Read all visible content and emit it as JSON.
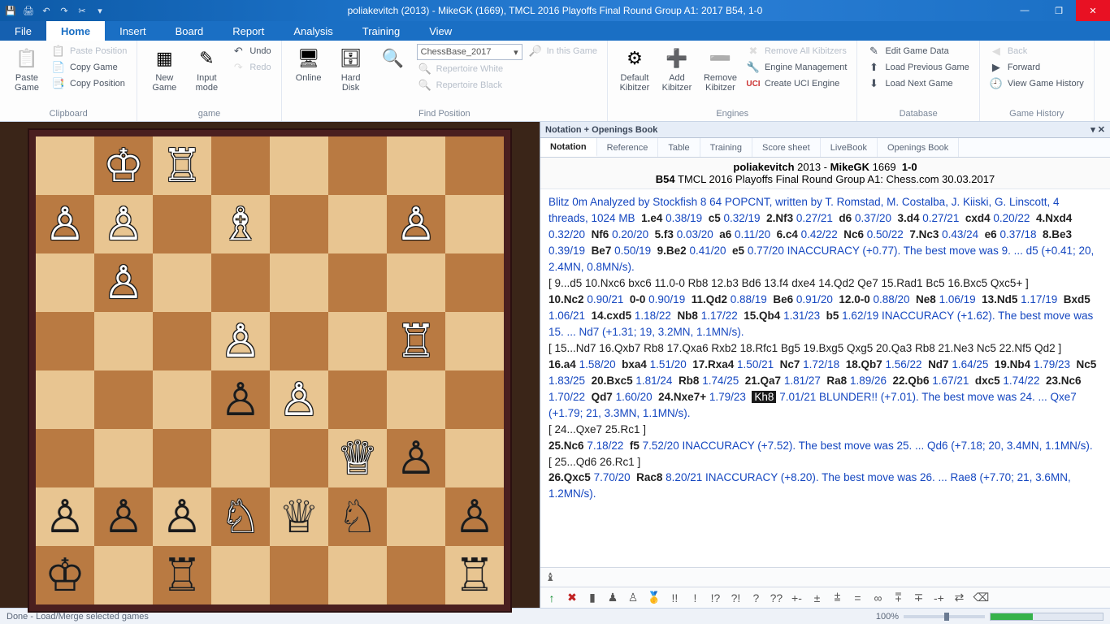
{
  "title": "poliakevitch (2013) - MikeGK (1669), TMCL 2016 Playoffs Final Round Group A1: 2017  B54, 1-0",
  "menus": {
    "file": "File",
    "home": "Home",
    "insert": "Insert",
    "board": "Board",
    "report": "Report",
    "analysis": "Analysis",
    "training": "Training",
    "view": "View"
  },
  "ribbon": {
    "clipboard": {
      "label": "Clipboard",
      "paste_game": "Paste\nGame",
      "paste_position": "Paste Position",
      "copy_game": "Copy Game",
      "copy_position": "Copy Position"
    },
    "game": {
      "label": "game",
      "new_game": "New\nGame",
      "input_mode": "Input\nmode",
      "undo": "Undo",
      "redo": "Redo"
    },
    "find": {
      "label": "Find Position",
      "online": "Online",
      "hard_disk": "Hard\nDisk",
      "combo": "ChessBase_2017",
      "in_this_game": "In this Game",
      "rep_white": "Repertoire White",
      "rep_black": "Repertoire Black"
    },
    "engines": {
      "label": "Engines",
      "default_kibitzer": "Default\nKibitzer",
      "add_kibitzer": "Add\nKibitzer",
      "remove_kibitzer": "Remove\nKibitzer",
      "remove_all": "Remove All Kibitzers",
      "engine_mgmt": "Engine Management",
      "create_uci": "Create UCI Engine"
    },
    "database": {
      "label": "Database",
      "edit_game": "Edit Game Data",
      "load_prev": "Load Previous Game",
      "load_next": "Load Next Game"
    },
    "history": {
      "label": "Game History",
      "back": "Back",
      "forward": "Forward",
      "view_history": "View Game History"
    }
  },
  "pane_title": "Notation + Openings Book",
  "subtabs": [
    "Notation",
    "Reference",
    "Table",
    "Training",
    "Score sheet",
    "LiveBook",
    "Openings Book"
  ],
  "game_header": {
    "white": "poliakevitch",
    "white_elo": "2013",
    "black": "MikeGK",
    "black_elo": "1669",
    "result": "1-0",
    "eco": "B54",
    "event": "TMCL 2016 Playoffs Final Round Group A1: Chess.com 30.03.2017"
  },
  "notation": {
    "intro": "Blitz 0m Analyzed by Stockfish 8 64 POPCNT, written by T. Romstad, M. Costalba, J. Kiiski, G. Linscott, 4 threads, 1024 MB",
    "line1_moves": [
      {
        "n": "1.e4",
        "s": "0.38/19"
      },
      {
        "m": "c5",
        "s": "0.32/19"
      },
      {
        "n": "2.Nf3",
        "s": "0.27/21"
      },
      {
        "m": "d6",
        "s": "0.37/20"
      },
      {
        "n": "3.d4",
        "s": "0.27/21"
      },
      {
        "m": "cxd4",
        "s": "0.20/22"
      },
      {
        "n": "4.Nxd4",
        "s": "0.32/20"
      },
      {
        "m": "Nf6",
        "s": "0.20/20"
      },
      {
        "n": "5.f3",
        "s": "0.03/20"
      },
      {
        "m": "a6",
        "s": "0.11/20"
      },
      {
        "n": "6.c4",
        "s": "0.42/22"
      },
      {
        "m": "Nc6",
        "s": "0.50/22"
      },
      {
        "n": "7.Nc3",
        "s": "0.43/24"
      },
      {
        "m": "e6",
        "s": "0.37/18"
      },
      {
        "n": "8.Be3",
        "s": "0.39/19"
      },
      {
        "m": "Be7",
        "s": "0.50/19"
      },
      {
        "n": "9.Be2",
        "s": "0.41/20"
      },
      {
        "m": "e5",
        "s": "0.77/20"
      }
    ],
    "inacc1": "INACCURACY (+0.77). The best move was 9. ... d5 (+0.41; 20, 2.4MN, 0.8MN/s).",
    "var1": "[ 9...d5  10.Nxc6  bxc6  11.0-0  Rb8  12.b3  Bd6  13.f4  dxe4  14.Qd2  Qe7  15.Rad1  Bc5  16.Bxc5  Qxc5+ ]",
    "line2_moves": [
      {
        "n": "10.Nc2",
        "s": "0.90/21"
      },
      {
        "m": "0-0",
        "s": "0.90/19"
      },
      {
        "n": "11.Qd2",
        "s": "0.88/19"
      },
      {
        "m": "Be6",
        "s": "0.91/20"
      },
      {
        "n": "12.0-0",
        "s": "0.88/20"
      },
      {
        "m": "Ne8",
        "s": "1.06/19"
      },
      {
        "n": "13.Nd5",
        "s": "1.17/19"
      },
      {
        "m": "Bxd5",
        "s": "1.06/21"
      },
      {
        "n": "14.cxd5",
        "s": "1.18/22"
      },
      {
        "m": "Nb8",
        "s": "1.17/22"
      },
      {
        "n": "15.Qb4",
        "s": "1.31/23"
      },
      {
        "m": "b5",
        "s": "1.62/19"
      }
    ],
    "inacc2": "INACCURACY (+1.62). The best move was 15. ... Nd7 (+1.31; 19, 3.2MN, 1.1MN/s).",
    "var2": "[ 15...Nd7  16.Qxb7  Rb8  17.Qxa6  Rxb2  18.Rfc1  Bg5  19.Bxg5  Qxg5  20.Qa3  Rb8  21.Ne3  Nc5  22.Nf5  Qd2 ]",
    "line3_moves": [
      {
        "n": "16.a4",
        "s": "1.58/20"
      },
      {
        "m": "bxa4",
        "s": "1.51/20"
      },
      {
        "n": "17.Rxa4",
        "s": "1.50/21"
      },
      {
        "m": "Nc7",
        "s": "1.72/18"
      },
      {
        "n": "18.Qb7",
        "s": "1.56/22"
      },
      {
        "m": "Nd7",
        "s": "1.64/25"
      },
      {
        "n": "19.Nb4",
        "s": "1.79/23"
      },
      {
        "m": "Nc5",
        "s": "1.83/25"
      },
      {
        "n": "20.Bxc5",
        "s": "1.81/24"
      },
      {
        "m": "Rb8",
        "s": "1.74/25"
      },
      {
        "n": "21.Qa7",
        "s": "1.81/27"
      },
      {
        "m": "Ra8",
        "s": "1.89/26"
      },
      {
        "n": "22.Qb6",
        "s": "1.67/21"
      },
      {
        "m": "dxc5",
        "s": "1.74/22"
      },
      {
        "n": "23.Nc6",
        "s": "1.70/22"
      },
      {
        "m": "Qd7",
        "s": "1.60/20"
      },
      {
        "n": "24.Nxe7+",
        "s": "1.79/23"
      },
      {
        "hi": "Kh8",
        "s": "7.01/21"
      }
    ],
    "blunder": "BLUNDER!! (+7.01). The best move was 24. ... Qxe7 (+1.79; 21, 3.3MN, 1.1MN/s).",
    "var3": "[ 24...Qxe7  25.Rc1 ]",
    "line4": [
      {
        "n": "25.Nc6",
        "s": "7.18/22"
      },
      {
        "m": "f5",
        "s": "7.52/20"
      }
    ],
    "inacc3": "INACCURACY (+7.52). The best move was 25. ... Qd6 (+7.18; 20, 3.4MN, 1.1MN/s).",
    "var4": "[ 25...Qd6  26.Rc1 ]",
    "line5": [
      {
        "n": "26.Qxc5",
        "s": "7.70/20"
      },
      {
        "m": "Rac8",
        "s": "8.20/21"
      }
    ],
    "inacc4": "INACCURACY (+8.20). The best move was 26. ... Rae8 (+7.70; 21, 3.6MN, 1.2MN/s)."
  },
  "board": {
    "rows": [
      [
        "",
        "wK",
        "wR",
        "",
        "",
        "",
        "",
        ""
      ],
      [
        "wP",
        "wP",
        "",
        "wB",
        "",
        "",
        "wP",
        ""
      ],
      [
        "",
        "wP",
        "",
        "",
        "",
        "",
        "",
        ""
      ],
      [
        "",
        "",
        "",
        "wP",
        "",
        "",
        "wR",
        ""
      ],
      [
        "",
        "",
        "",
        "bP",
        "wP",
        "",
        "",
        ""
      ],
      [
        "",
        "",
        "",
        "",
        "",
        "wQ",
        "bP",
        ""
      ],
      [
        "bP",
        "bP",
        "bP",
        "wN",
        "bQ",
        "bN",
        "",
        "bP"
      ],
      [
        "bK",
        "",
        "bR",
        "",
        "",
        "",
        "",
        "bR"
      ]
    ]
  },
  "status": "Done - Load/Merge selected games",
  "zoom": "100%",
  "tool_glyphs": [
    "!!",
    "!",
    "!?",
    "?!",
    "?",
    "??",
    "+-",
    "±",
    "⩲",
    "=",
    "∞",
    "⩱",
    "∓",
    "-+",
    "⇄"
  ]
}
